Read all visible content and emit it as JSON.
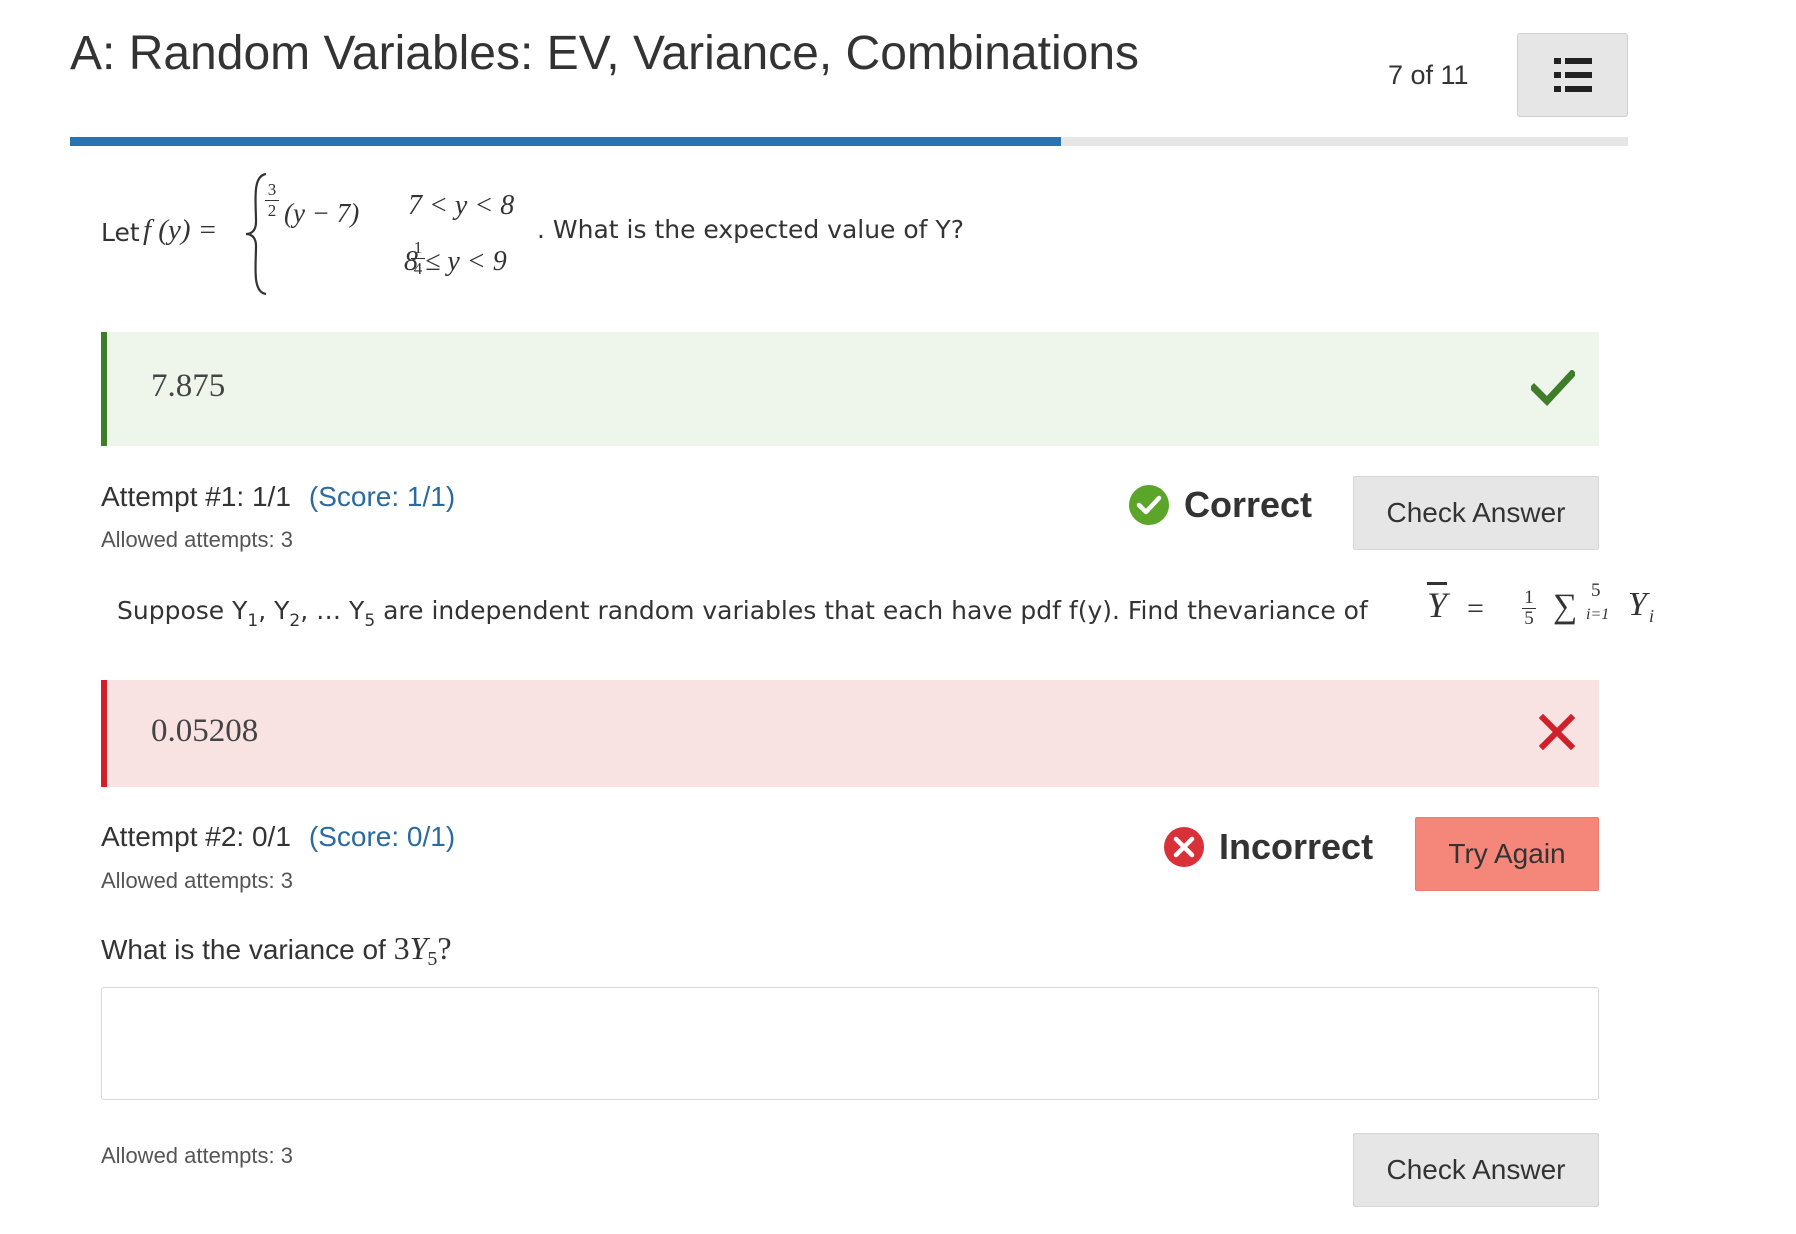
{
  "header": {
    "title": "A: Random Variables: EV, Variance, Combinations",
    "counter": "7 of 11",
    "menu_icon": "list-icon",
    "progress_fraction": 0.636
  },
  "question1": {
    "prefix": "Let",
    "func": "f (y) =",
    "case1_expr": "(y − 7)",
    "case1_frac_num": "3",
    "case1_frac_den": "2",
    "case1_cond": "7 < y < 8",
    "case2_frac_num": "1",
    "case2_frac_den": "4",
    "case2_cond": "8 ≤ y < 9",
    "suffix": ". What is the expected value of Y?"
  },
  "answer1": {
    "value": "7.875",
    "status_icon": "checkmark-icon"
  },
  "attempt1": {
    "label": "Attempt #1: 1/1",
    "score": "(Score: 1/1)",
    "allowed": "Allowed attempts: 3",
    "result": "Correct",
    "result_icon": "check-circle-icon",
    "button": "Check Answer"
  },
  "question2": {
    "text_part1": "Suppose Y",
    "sub1": "1",
    "sep1": ", Y",
    "sub2": "2",
    "sep2": ", … Y",
    "sub3": "5",
    "text_part2": " are independent random variables that each have pdf f(y). Find thevariance of ",
    "formula_ybar": "Y",
    "formula_eq": "=",
    "formula_frac_num": "1",
    "formula_frac_den": "5",
    "formula_sigma": "∑",
    "formula_sigma_sup": "5",
    "formula_sigma_sub": "i=1",
    "formula_term": "Y",
    "formula_term_sub": "i"
  },
  "answer2": {
    "value": "0.05208",
    "status_icon": "x-icon"
  },
  "attempt2": {
    "label": "Attempt #2: 0/1",
    "score": "(Score: 0/1)",
    "allowed": "Allowed attempts: 3",
    "result": "Incorrect",
    "result_icon": "x-circle-icon",
    "button": "Try Again"
  },
  "question3": {
    "text": "What is the variance of",
    "math_coef": "3",
    "math_var": "Y",
    "math_sub": "5",
    "math_end": "?",
    "input_value": "",
    "allowed": "Allowed attempts: 3",
    "button": "Check Answer"
  },
  "colors": {
    "accent_blue": "#2b72b1",
    "correct_green": "#3f7d2b",
    "correct_bg": "#eef6ec",
    "incorrect_red": "#d0202c",
    "incorrect_bg": "#f9e2e2",
    "try_again_bg": "#f5867a"
  }
}
